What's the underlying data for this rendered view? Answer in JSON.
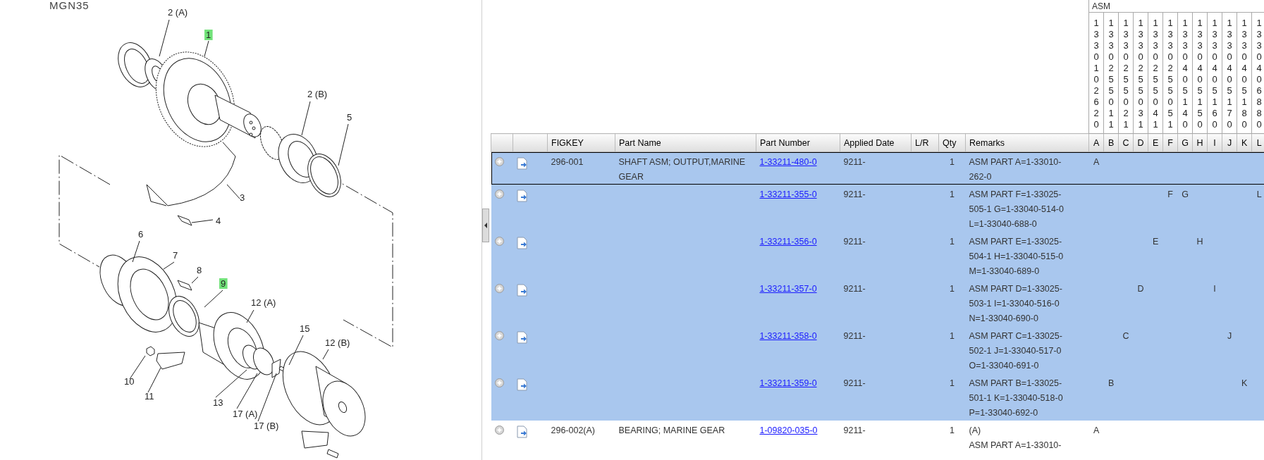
{
  "drawing": {
    "title": "MGN35",
    "callouts": [
      {
        "label": "2 (A)",
        "highlighted": false
      },
      {
        "label": "1",
        "highlighted": true
      },
      {
        "label": "2 (B)",
        "highlighted": false
      },
      {
        "label": "5",
        "highlighted": false
      },
      {
        "label": "3",
        "highlighted": false
      },
      {
        "label": "4",
        "highlighted": false
      },
      {
        "label": "6",
        "highlighted": false
      },
      {
        "label": "7",
        "highlighted": false
      },
      {
        "label": "8",
        "highlighted": false
      },
      {
        "label": "9",
        "highlighted": true
      },
      {
        "label": "12 (A)",
        "highlighted": false
      },
      {
        "label": "15",
        "highlighted": false
      },
      {
        "label": "12 (B)",
        "highlighted": false
      },
      {
        "label": "10",
        "highlighted": false
      },
      {
        "label": "11",
        "highlighted": false
      },
      {
        "label": "13",
        "highlighted": false
      },
      {
        "label": "17 (A)",
        "highlighted": false
      },
      {
        "label": "17 (B)",
        "highlighted": false
      }
    ]
  },
  "table": {
    "asm_group": "ASM",
    "asm_columns": [
      {
        "code": "1330102620",
        "letter": "A"
      },
      {
        "code": "1330255011",
        "letter": "B"
      },
      {
        "code": "1330255021",
        "letter": "C"
      },
      {
        "code": "1330255031",
        "letter": "D"
      },
      {
        "code": "1330255041",
        "letter": "E"
      },
      {
        "code": "1330255051",
        "letter": "F"
      },
      {
        "code": "1330405140",
        "letter": "G"
      },
      {
        "code": "1330405150",
        "letter": "H"
      },
      {
        "code": "1330405160",
        "letter": "I"
      },
      {
        "code": "1330405170",
        "letter": "J"
      },
      {
        "code": "1330405180",
        "letter": "K"
      },
      {
        "code": "1330406880",
        "letter": "L"
      }
    ],
    "columns": [
      "FIGKEY",
      "Part Name",
      "Part Number",
      "Applied Date",
      "L/R",
      "Qty",
      "Remarks"
    ],
    "rows": [
      {
        "highlighted": true,
        "selected": true,
        "figkey": "296-001",
        "part_name": [
          "SHAFT ASM; OUTPUT,MARINE",
          "GEAR"
        ],
        "part_number": "1-33211-480-0",
        "applied_date": "9211-",
        "qty": "1",
        "remarks": [
          "ASM PART A=1-33010-",
          "262-0"
        ],
        "asm": [
          {
            "marked": true,
            "label": "A"
          },
          {
            "marked": false
          },
          {
            "marked": false
          },
          {
            "marked": false
          },
          {
            "marked": false
          },
          {
            "marked": false
          },
          {
            "marked": false
          },
          {
            "marked": false
          },
          {
            "marked": false
          },
          {
            "marked": false
          },
          {
            "marked": false
          },
          {
            "marked": false
          }
        ]
      },
      {
        "highlighted": true,
        "selected": false,
        "part_number": "1-33211-355-0",
        "applied_date": "9211-",
        "qty": "1",
        "remarks": [
          "ASM PART F=1-33025-",
          "505-1 G=1-33040-514-0",
          "L=1-33040-688-0"
        ],
        "asm": [
          {
            "marked": false
          },
          {
            "marked": false
          },
          {
            "marked": false
          },
          {
            "marked": false
          },
          {
            "marked": false
          },
          {
            "marked": true,
            "label": "F"
          },
          {
            "marked": true,
            "label": "G"
          },
          {
            "marked": false
          },
          {
            "marked": false
          },
          {
            "marked": false
          },
          {
            "marked": false
          },
          {
            "marked": true,
            "label": "L"
          }
        ]
      },
      {
        "highlighted": true,
        "selected": false,
        "part_number": "1-33211-356-0",
        "applied_date": "9211-",
        "qty": "1",
        "remarks": [
          "ASM PART E=1-33025-",
          "504-1 H=1-33040-515-0",
          "M=1-33040-689-0"
        ],
        "asm": [
          {
            "marked": false
          },
          {
            "marked": false
          },
          {
            "marked": false
          },
          {
            "marked": false
          },
          {
            "marked": true,
            "label": "E"
          },
          {
            "marked": false
          },
          {
            "marked": false
          },
          {
            "marked": true,
            "label": "H"
          },
          {
            "marked": false
          },
          {
            "marked": false
          },
          {
            "marked": false
          },
          {
            "marked": false
          }
        ]
      },
      {
        "highlighted": true,
        "selected": false,
        "part_number": "1-33211-357-0",
        "applied_date": "9211-",
        "qty": "1",
        "remarks": [
          "ASM PART D=1-33025-",
          "503-1 I=1-33040-516-0",
          "N=1-33040-690-0"
        ],
        "asm": [
          {
            "marked": false
          },
          {
            "marked": false
          },
          {
            "marked": false
          },
          {
            "marked": true,
            "label": "D"
          },
          {
            "marked": false
          },
          {
            "marked": false
          },
          {
            "marked": false
          },
          {
            "marked": false
          },
          {
            "marked": true,
            "label": "I"
          },
          {
            "marked": false
          },
          {
            "marked": false
          },
          {
            "marked": false
          }
        ]
      },
      {
        "highlighted": true,
        "selected": false,
        "part_number": "1-33211-358-0",
        "applied_date": "9211-",
        "qty": "1",
        "remarks": [
          "ASM PART C=1-33025-",
          "502-1 J=1-33040-517-0",
          "O=1-33040-691-0"
        ],
        "asm": [
          {
            "marked": false
          },
          {
            "marked": false
          },
          {
            "marked": true,
            "label": "C"
          },
          {
            "marked": false
          },
          {
            "marked": false
          },
          {
            "marked": false
          },
          {
            "marked": false
          },
          {
            "marked": false
          },
          {
            "marked": false
          },
          {
            "marked": true,
            "label": "J"
          },
          {
            "marked": false
          },
          {
            "marked": false
          }
        ]
      },
      {
        "highlighted": true,
        "selected": false,
        "part_number": "1-33211-359-0",
        "applied_date": "9211-",
        "qty": "1",
        "remarks": [
          "ASM PART B=1-33025-",
          "501-1 K=1-33040-518-0",
          "P=1-33040-692-0"
        ],
        "asm": [
          {
            "marked": false
          },
          {
            "marked": true,
            "label": "B"
          },
          {
            "marked": false
          },
          {
            "marked": false
          },
          {
            "marked": false
          },
          {
            "marked": false
          },
          {
            "marked": false
          },
          {
            "marked": false
          },
          {
            "marked": false
          },
          {
            "marked": false
          },
          {
            "marked": true,
            "label": "K"
          },
          {
            "marked": false
          }
        ]
      },
      {
        "highlighted": false,
        "selected": false,
        "figkey": "296-002(A)",
        "part_name": [
          "BEARING; MARINE GEAR"
        ],
        "part_number": "1-09820-035-0",
        "applied_date": "9211-",
        "qty": "1",
        "remarks": [
          "(A)",
          "ASM PART A=1-33010-"
        ],
        "asm": [
          {
            "marked": true,
            "label": "A"
          },
          {
            "marked": false
          },
          {
            "marked": false
          },
          {
            "marked": false
          },
          {
            "marked": false
          },
          {
            "marked": false
          },
          {
            "marked": false
          },
          {
            "marked": false
          },
          {
            "marked": false
          },
          {
            "marked": false
          },
          {
            "marked": false
          },
          {
            "marked": false
          }
        ]
      }
    ]
  }
}
